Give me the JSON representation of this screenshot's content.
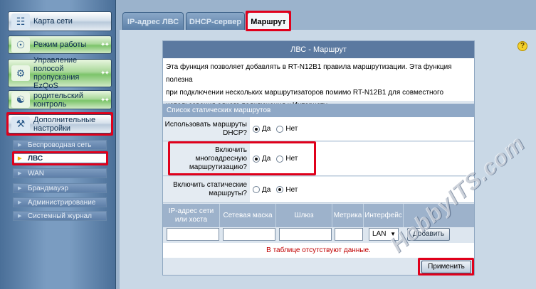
{
  "sidebar": {
    "menu": [
      {
        "label": "Карта сети",
        "icon": "network-map-icon"
      },
      {
        "label": "Режим работы",
        "icon": "wifi-mode-icon"
      },
      {
        "label": "Управление полосой пропускания EzQoS",
        "icon": "qos-icon"
      },
      {
        "label": "родительский контроль",
        "icon": "parental-control-icon"
      },
      {
        "label": "Дополнительные настройки",
        "icon": "tools-icon"
      }
    ],
    "submenu": [
      "Беспроводная сеть",
      "ЛВС",
      "WAN",
      "Брандмауэр",
      "Администрирование",
      "Системный журнал"
    ]
  },
  "tabs": [
    "IP-адрес ЛВС",
    "DHCP-сервер",
    "Маршрут"
  ],
  "panel": {
    "title": "ЛВС - Маршрут",
    "description": "Эта функция позволяет добавлять в RT-N12B1 правила маршрутизации. Эта функция полезна при подключении нескольких маршрутизаторов помимо RT-N12B1 для совместного использования одного подключения к Интернету.",
    "description_lines": [
      "Эта функция позволяет добавлять в RT-N12B1 правила маршрутизации. Эта функция полезна",
      "при подключении нескольких маршрутизаторов помимо RT-N12B1 для совместного",
      "использования одного подключения к Интернету."
    ],
    "section_title": "Список статических маршрутов",
    "rows": [
      {
        "label": "Использовать маршруты DHCP?",
        "selected": "Да"
      },
      {
        "label": "Включить многоадресную маршрутизацию?",
        "selected": "Да"
      },
      {
        "label": "Включить статические маршруты?",
        "selected": "Нет"
      }
    ],
    "option_yes": "Да",
    "option_no": "Нет",
    "table": {
      "headers": [
        "IP-адрес сети или хоста",
        "Сетевая маска",
        "Шлюз",
        "Метрика",
        "Интерфейс"
      ],
      "interface_value": "LAN",
      "add_label": "Добавить",
      "empty_text": "В таблице отсутствуют данные."
    },
    "apply_label": "Применить"
  },
  "help_label": "?",
  "watermark": "HobbyITS.com"
}
